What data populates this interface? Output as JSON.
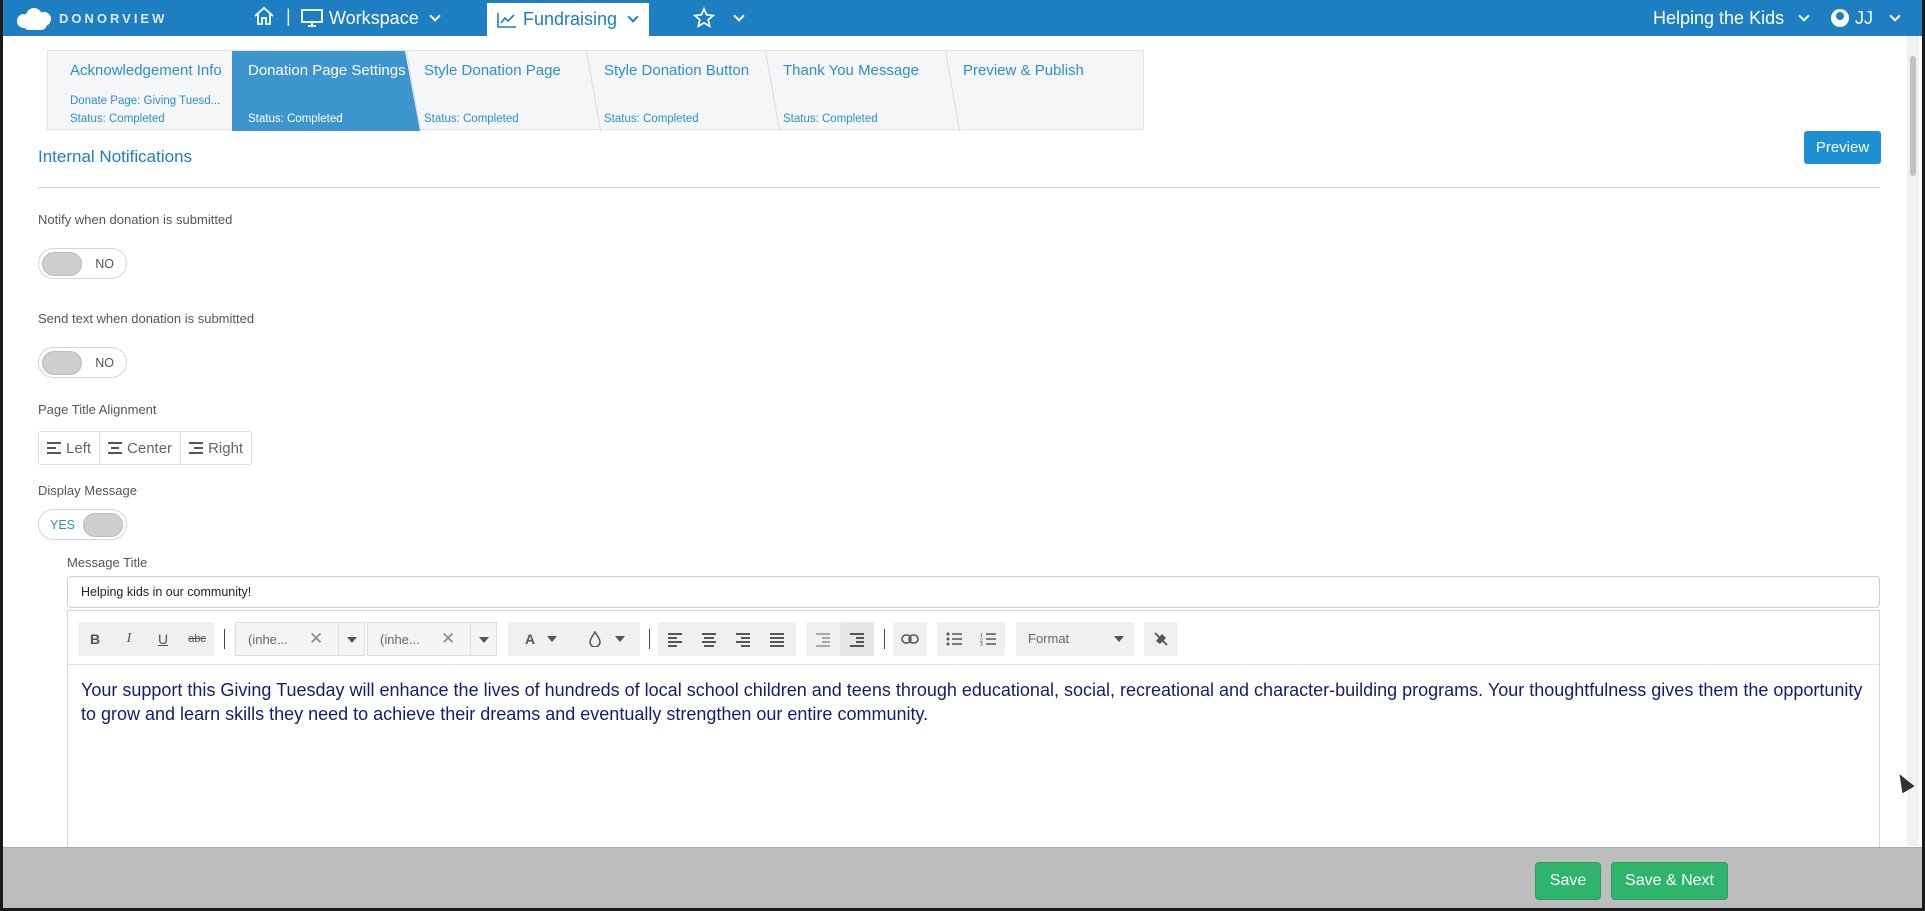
{
  "topnav": {
    "logo_text": "DONORVIEW",
    "workspace_label": "Workspace",
    "fundraising_label": "Fundraising",
    "org_label": "Helping the Kids",
    "user_label": "JJ",
    "accent": "#1d7fc1"
  },
  "steps": [
    {
      "title": "Acknowledgement Info",
      "sub": "Donate Page: Giving Tuesd...",
      "status": "Status: Completed"
    },
    {
      "title": "Donation Page Settings",
      "sub": "",
      "status": "Status: Completed"
    },
    {
      "title": "Style Donation Page",
      "sub": "",
      "status": "Status: Completed"
    },
    {
      "title": "Style Donation Button",
      "sub": "",
      "status": "Status: Completed"
    },
    {
      "title": "Thank You Message",
      "sub": "",
      "status": "Status: Completed"
    },
    {
      "title": "Preview & Publish",
      "sub": "",
      "status": ""
    }
  ],
  "active_step": "Donation Page Settings",
  "preview_label": "Preview",
  "section_title": "Internal Notifications",
  "fields": {
    "notify_label": "Notify when donation is submitted",
    "notify_value": "NO",
    "text_label": "Send text when donation is submitted",
    "text_value": "NO",
    "alignment_label": "Page Title Alignment",
    "align_left": "Left",
    "align_center": "Center",
    "align_right": "Right",
    "display_message_label": "Display Message",
    "display_message_value": "YES",
    "message_title_label": "Message Title",
    "message_title_value": "Helping kids in our community!"
  },
  "editor": {
    "font_family_value": "(inhe...",
    "font_size_value": "(inhe...",
    "format_label": "Format",
    "body": "Your support this Giving Tuesday will enhance the lives of hundreds of local school children and teens through educational, social, recreational and character-building programs. Your thoughtfulness gives them the opportunity to grow and learn skills they need to achieve their dreams and eventually strengthen our entire community.",
    "text_color": "#141d6e"
  },
  "footer": {
    "save_label": "Save",
    "save_next_label": "Save & Next",
    "button_color": "#2fb46c"
  }
}
